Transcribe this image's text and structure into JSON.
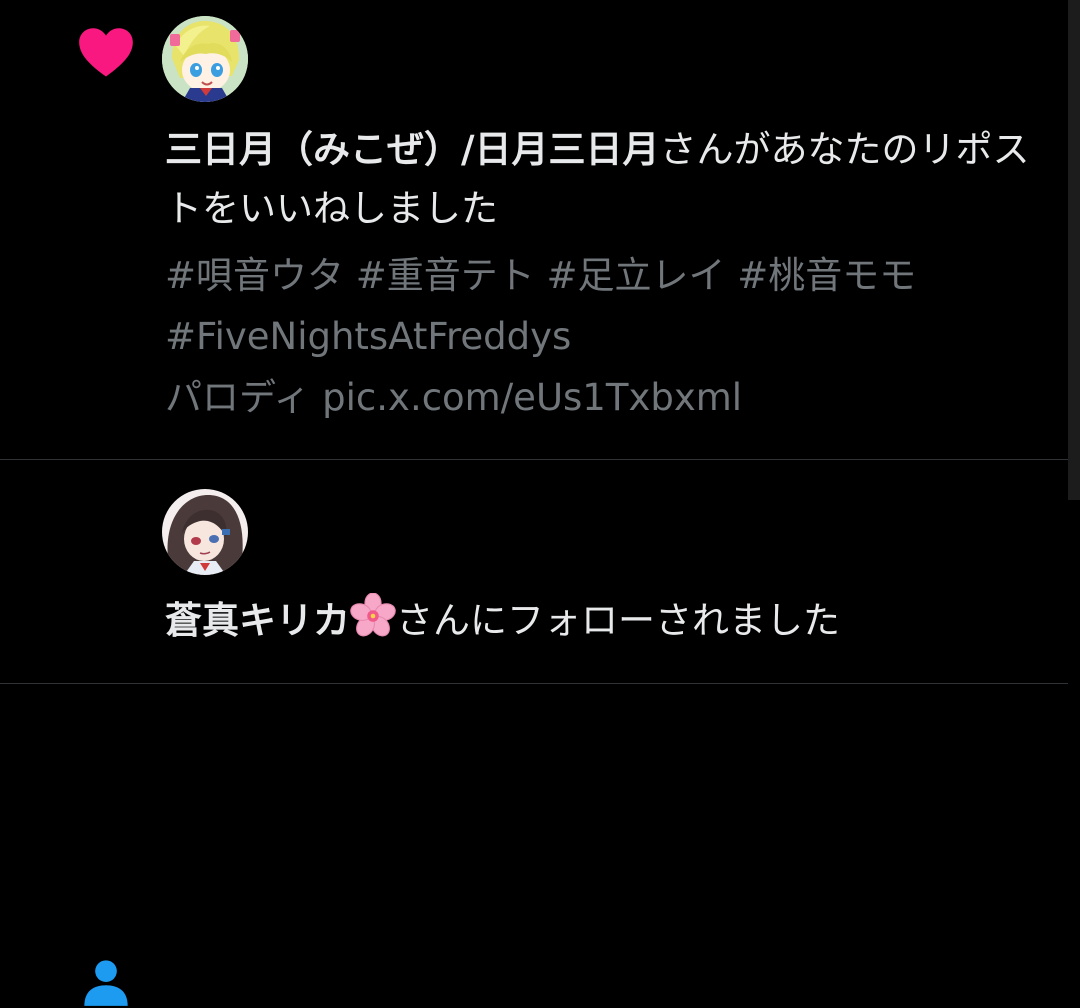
{
  "notifications": [
    {
      "type": "like",
      "user_name": "三日月（みこぜ）/日月三日月",
      "action_text": "さんがあなたのリポストをいいねしました",
      "preview": {
        "line1": "#唄音ウタ #重音テト #足立レイ #桃音モモ",
        "line2": "#FiveNightsAtFreddys",
        "line3": "パロディ pic.x.com/eUs1Txbxml"
      },
      "icon": "heart-icon",
      "icon_color": "#f91880"
    },
    {
      "type": "follow",
      "user_name": "蒼真キリカ",
      "action_text": "さんにフォローされました",
      "icon": "person-icon",
      "icon_color": "#1d9bf0",
      "name_emoji": "cherry-blossom-emoji"
    }
  ],
  "colors": {
    "background": "#000000",
    "text": "#e7e9ea",
    "secondary_text": "#71767b",
    "divider": "#2f3336"
  }
}
